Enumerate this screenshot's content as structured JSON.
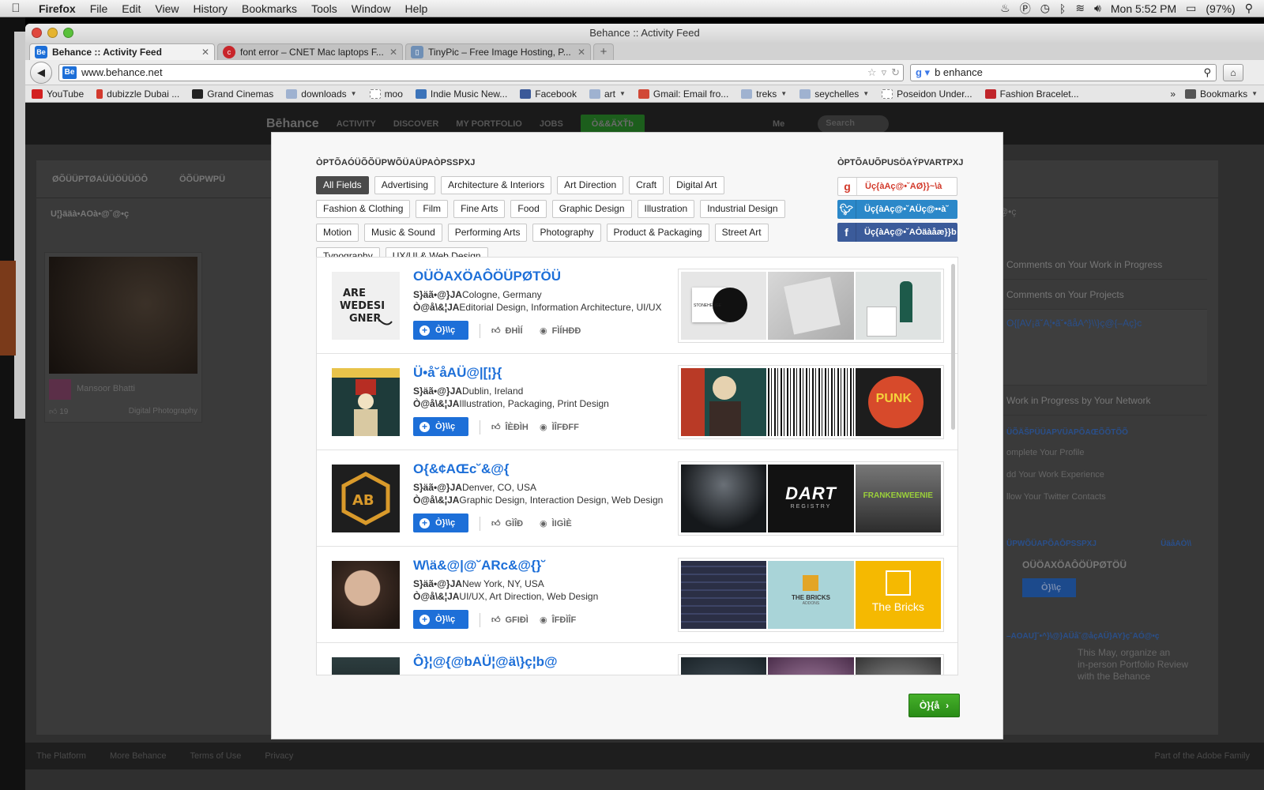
{
  "menubar": {
    "app": "Firefox",
    "items": [
      "File",
      "Edit",
      "View",
      "History",
      "Bookmarks",
      "Tools",
      "Window",
      "Help"
    ],
    "clock": "Mon 5:52 PM",
    "battery": "(97%)"
  },
  "window": {
    "title": "Behance :: Activity Feed",
    "tabs": [
      {
        "label": "Behance :: Activity Feed",
        "icon": "Be",
        "color": "#1d6fd8"
      },
      {
        "label": "font error – CNET Mac laptops F...",
        "icon": "c",
        "color": "#c8252a"
      },
      {
        "label": "TinyPic – Free Image Hosting, P...",
        "icon": "▯",
        "color": "#6f8fb5"
      }
    ],
    "url": "www.behance.net",
    "search": "b enhance",
    "bookmarks": [
      {
        "label": "YouTube",
        "color": "#d32020"
      },
      {
        "label": "dubizzle Dubai ...",
        "color": "#d33a2e"
      },
      {
        "label": "Grand Cinemas",
        "color": "#222222"
      },
      {
        "label": "downloads",
        "color": "#9fb2d0"
      },
      {
        "label": "moo",
        "color": "#dddddd"
      },
      {
        "label": "Indie Music New...",
        "color": "#3b73b9"
      },
      {
        "label": "Facebook",
        "color": "#3b5998"
      },
      {
        "label": "art",
        "color": "#9fb2d0"
      },
      {
        "label": "Gmail: Email fro...",
        "color": "#d14836"
      },
      {
        "label": "treks",
        "color": "#9fb2d0"
      },
      {
        "label": "seychelles",
        "color": "#9fb2d0"
      },
      {
        "label": "Poseidon Under...",
        "color": "#dddddd"
      },
      {
        "label": "Fashion Bracelet...",
        "color": "#c0252a"
      }
    ],
    "bookmarks_menu": "Bookmarks"
  },
  "behance": {
    "logo": "Bēhance",
    "nav": [
      "ACTIVITY",
      "DISCOVER",
      "MY PORTFOLIO",
      "JOBS"
    ],
    "cta": "Ò&&ÄXŤb",
    "me": "Me",
    "search_placeholder": "Search",
    "subtabs": [
      "ØÕÜÜPTØAÜÜÖÜÜÖÔ",
      "ÖÕÜPWPÜ"
    ],
    "feed_heading": "U¦}ääà•AOà•@˘@•ç",
    "card": {
      "name": "Mansoor Bhatti",
      "likes": "19",
      "field": "Digital Photography"
    },
    "right_heading": "‚Ö˘@•ç",
    "right_items": [
      "Comments on Your Work in Progress",
      "Comments on Your Projects",
      "O{[AV¡ã˘A¦•ã˘•ãåA^}\\\\}ç@{–Aç}c",
      "Work in Progress by Your Network"
    ],
    "profile_section": "ÜÕÄŠPÜÜAPVÜAPÕAŒÕÕTÕÕ",
    "profile_items": [
      "omplete Your Profile",
      "dd Your Work Experience",
      "llow Your Twitter Contacts"
    ],
    "follow_section": "ÜPWÕÜAPÕAÔPSSPXJ",
    "follow_more": "ÜäåAÒ\\\\",
    "follow_name": "OÜÖAXÖAÔÖÜPØTÖÜ",
    "follow_btn": "Ò}\\\\ç",
    "review_heading": "–AOAU]˘•^}\\@}AÜå˘@åçAÜ}AY}ç˘AÓ@•ç",
    "review_text": [
      "This May, organize an",
      "in-person Portfolio Review",
      "with the Behance"
    ],
    "footer": [
      "The Platform",
      "More Behance",
      "Terms of Use",
      "Privacy"
    ],
    "footer_right": "Part of the Adobe Family"
  },
  "modal": {
    "title": "ÒPTÕAÓÜÕÕÜPWÕÜAÜPAÒPSSPXJ",
    "social_title": "ÒPTÕAUÕPUSÖAÝPVARTPXJ",
    "filters": [
      "All Fields",
      "Advertising",
      "Architecture & Interiors",
      "Art Direction",
      "Craft",
      "Digital Art",
      "Fashion & Clothing",
      "Film",
      "Fine Arts",
      "Food",
      "Graphic Design",
      "Illustration",
      "Industrial Design",
      "Motion",
      "Music & Sound",
      "Performing Arts",
      "Photography",
      "Product & Packaging",
      "Street Art",
      "Typography",
      "UX/UI & Web Design"
    ],
    "social": [
      {
        "icon": "g",
        "label": "Üç{àAç@•˘AØ}}~\\à"
      },
      {
        "icon": "t",
        "label": "Üç{àAç@•˘AÜç@••à˘"
      },
      {
        "icon": "f",
        "label": "Üç{àAç@•˘AÒäàåæ}}b"
      }
    ],
    "loc_label": "S}äã•@}JA",
    "fields_label": "Ò@å\\&¦JA",
    "follow_label": "Ò}\\\\ç",
    "next_label": "Ò}{å",
    "creatives": [
      {
        "name": "OÜÖAXÖAÔÖÜPØTÖÜ",
        "location": "Cologne, Germany",
        "fields": "Editorial Design, Information Architecture, UI/UX",
        "likes": "ÐHÌÍ",
        "views": "FÌÍHÐÐ"
      },
      {
        "name": "Ü•å˘åAÜ@|[¦}{",
        "location": "Dublin, Ireland",
        "fields": "Illustration, Packaging, Print Design",
        "likes": "ÎÈÐÌH",
        "views": "ÌÎFÐFF"
      },
      {
        "name": "O{&¢AŒc˘&@{",
        "location": "Denver, CO, USA",
        "fields": "Graphic Design, Interaction Design, Web Design",
        "likes": "GÌÎÐ",
        "views": "ÌIGÌÈ"
      },
      {
        "name": "W\\ä&@|@˘ARc&@{}˘",
        "location": "New York, NY, USA",
        "fields": "UI/UX, Art Direction, Web Design",
        "likes": "GFIÐÌ",
        "views": "ÎFÐÌÎF"
      },
      {
        "name": "Ô}¦@{@bAÜ¦@ä\\}ç¦b@",
        "location": "",
        "fields": "",
        "likes": "",
        "views": ""
      }
    ],
    "work_labels": {
      "stonehenge": "STONEHENGE",
      "dart": "DART",
      "registry": "REGISTRY",
      "frankenweenie": "FRANKENWEENIE",
      "bricks_tile": "THE BRICKS",
      "addons": "ADDONS",
      "bricks": "The Bricks",
      "punk": "PUNK"
    }
  },
  "colors": {
    "accent": "#1d6fd8",
    "next": "#3a9e20",
    "twitter": "#2b88c9",
    "facebook": "#3b5b9a"
  }
}
